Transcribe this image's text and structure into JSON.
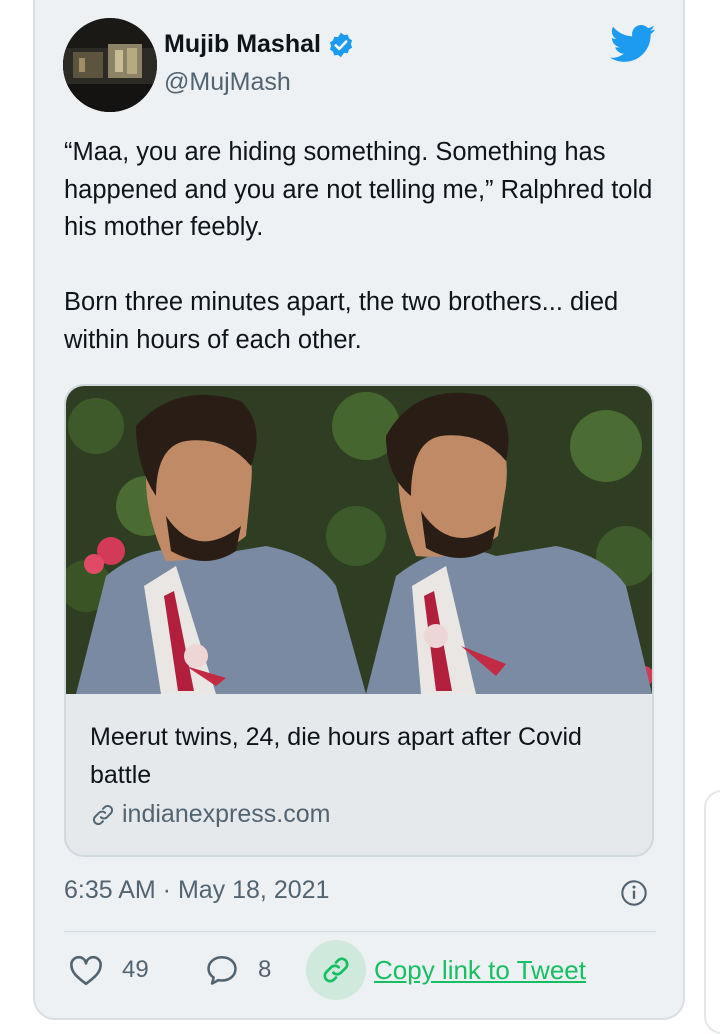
{
  "author": {
    "name": "Mujib Mashal",
    "handle": "@MujMash"
  },
  "tweet": {
    "paragraph1": "“Maa, you are hiding something. Something has happened and you are not telling me,” Ralphred told his mother feebly.",
    "paragraph2": "Born three minutes apart, the two brothers... died within hours of each other."
  },
  "link_card": {
    "title": "Meerut twins, 24, die hours apart after Covid battle",
    "domain": "indianexpress.com"
  },
  "timestamp": "6:35 AM · May 18, 2021",
  "actions": {
    "likes": "49",
    "replies": "8",
    "copy_link_label": "Copy link to Tweet"
  },
  "icons": [
    "verified-badge-icon",
    "twitter-bird-icon",
    "link-icon",
    "info-icon",
    "heart-icon",
    "reply-bubble-icon"
  ],
  "colors": {
    "twitter_blue": "#1d9bf0",
    "copy_link_green": "#17bf63",
    "card_background": "#eef1f4"
  }
}
